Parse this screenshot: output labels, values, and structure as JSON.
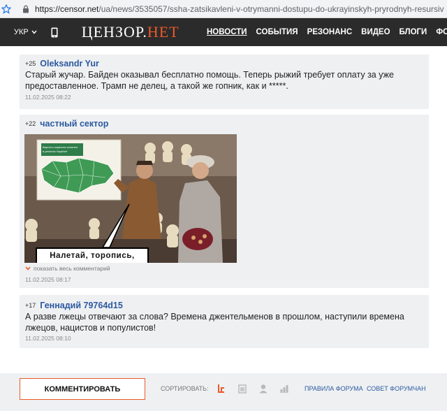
{
  "browser": {
    "url_host": "https://censor.net",
    "url_path": "/ua/news/3535057/ssha-zatsikavleni-v-otrymanni-dostupu-do-ukrayinskyh-pryrodnyh-resursiv"
  },
  "header": {
    "lang": "УКР",
    "logo_main": "ЦЕНЗОР.",
    "logo_accent": "НЕТ",
    "nav": [
      "НОВОСТИ",
      "СОБЫТИЯ",
      "РЕЗОНАНС",
      "ВИДЕО",
      "БЛОГИ",
      "ФОРУМ"
    ]
  },
  "comments": [
    {
      "score": "+25",
      "author": "Oleksandr Yur",
      "text": "Старый жучар. Байден оказывал бесплатно помощь. Теперь рыжий требует оплату за уже предоставленное. Трамп не делец, а такой же гопник, как и *****.",
      "date": "11.02.2025 08:22"
    },
    {
      "score": "+22",
      "author": "частный сектор",
      "image_caption": "Налетай, торопись,",
      "image_map_title": "Вартість корисних копалин в регіонах України*",
      "show_full": "показать весь комментарий",
      "date": "11.02.2025 08:17"
    },
    {
      "score": "+17",
      "author": "Геннадий 79764d15",
      "text": "А разве лжецы отвечают за слова? Времена джентельменов в прошлом, наступили времена лжецов, нацистов и популистов!",
      "date": "11.02.2025 08:10"
    }
  ],
  "bottombar": {
    "comment_button": "КОММЕНТИРОВАТЬ",
    "sort_label": "СОРТИРОВАТЬ:",
    "forum_rules": "ПРАВИЛА ФОРУМА",
    "forum_tips": "СОВЕТ ФОРУМЧАН"
  },
  "colors": {
    "accent": "#ec5a29",
    "link": "#2c5aa0",
    "header_bg": "#2b2b2b",
    "comment_bg": "#eef0f2"
  }
}
